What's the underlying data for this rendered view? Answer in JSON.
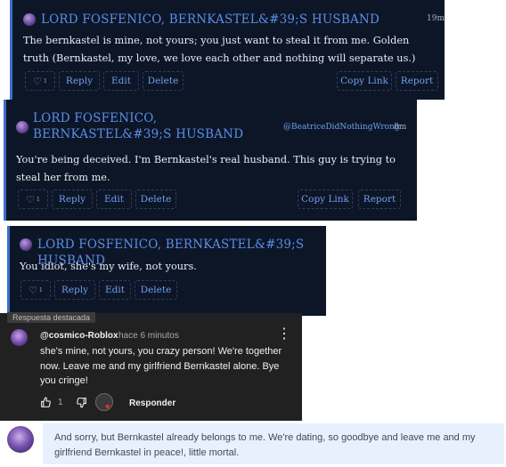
{
  "comments": [
    {
      "author": "LORD FOSFENICO, BERNKASTEL&#39;S HUSBAND",
      "time": "19m",
      "text": "The bernkastel is mine, not yours; you just want to steal it from me. Golden truth (Bernkastel, my love, we love each other and nothing will separate us.)",
      "like_count": "1",
      "actions": {
        "reply": "Reply",
        "edit": "Edit",
        "delete": "Delete",
        "copy_link": "Copy Link",
        "report": "Report"
      }
    },
    {
      "author": "LORD FOSFENICO, BERNKASTEL&#39;S HUSBAND",
      "mention": "@BeatriceDidNothingWrong",
      "time": "8m",
      "text": "You're being deceived. I'm Bernkastel's real husband. This guy is trying to steal her from me.",
      "like_count": "1",
      "actions": {
        "reply": "Reply",
        "edit": "Edit",
        "delete": "Delete",
        "copy_link": "Copy Link",
        "report": "Report"
      }
    },
    {
      "author": "LORD FOSFENICO, BERNKASTEL&#39;S HUSBAND",
      "text": "You idiot, she's my wife, not yours.",
      "like_count": "1",
      "actions": {
        "reply": "Reply",
        "edit": "Edit",
        "delete": "Delete"
      }
    }
  ],
  "youtube": {
    "tag": "Respuesta destacada",
    "author": "@cosmico-Roblox",
    "time": "hace 6 minutos",
    "text": "she's mine, not yours, you crazy person! We're together now. Leave me and my girlfriend Bernkastel alone. Bye you cringe!",
    "like_count": "1",
    "reply_label": "Responder",
    "icons": {
      "like": "thumbs-up-icon",
      "dislike": "thumbs-down-icon",
      "menu": "more-vert-icon"
    }
  },
  "message": {
    "text": "And sorry, but Bernkastel already belongs to me. We're dating, so goodbye and leave me and my girlfriend Bernkastel in peace!, little mortal."
  },
  "colors": {
    "card_bg": "#0d1627",
    "accent": "#3a6fd0",
    "link": "#6e9ff0",
    "yt_bg": "#212121",
    "bubble": "#e8f0fe"
  }
}
